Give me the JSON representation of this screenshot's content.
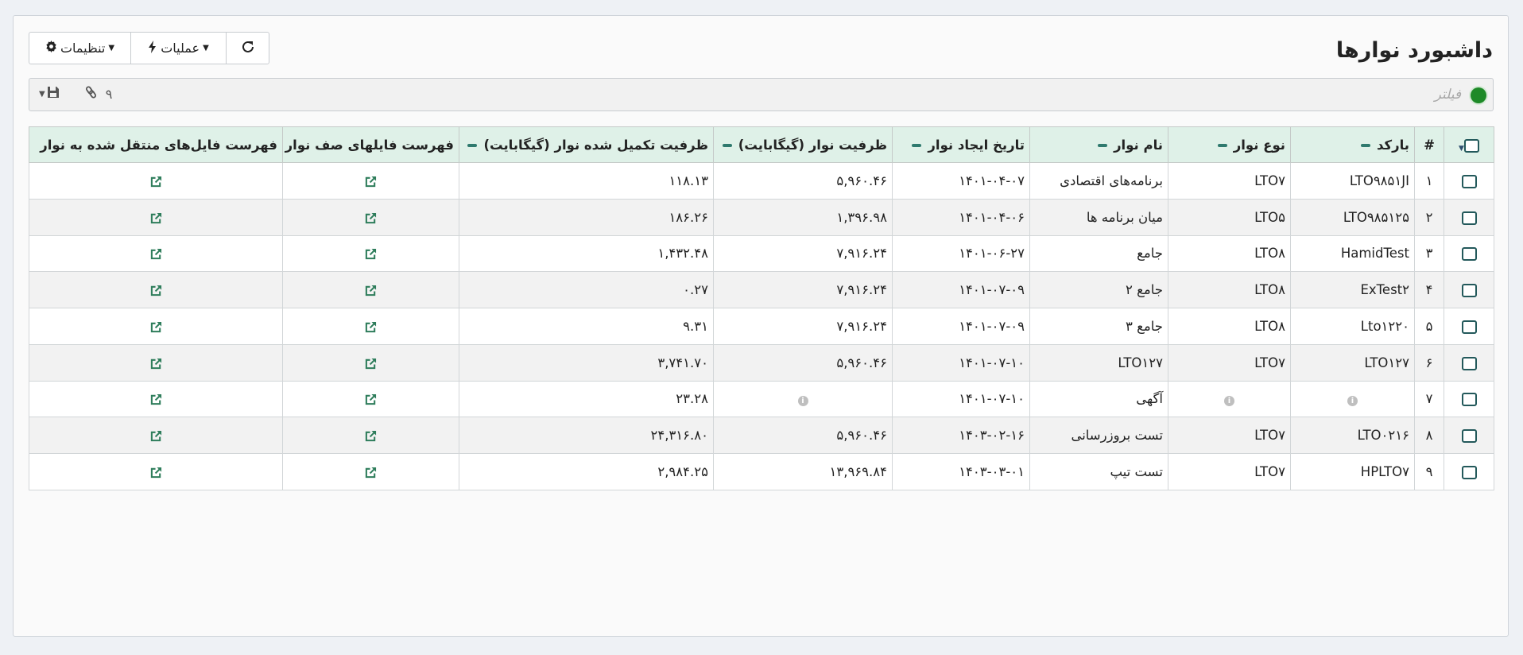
{
  "page": {
    "title": "داشبورد نوارها"
  },
  "toolbar": {
    "settings_label": "تنظیمات",
    "operations_label": "عملیات"
  },
  "filter": {
    "placeholder": "فیلتر",
    "count": "۹",
    "status_color": "#1e8a28"
  },
  "table": {
    "columns": [
      "#",
      "بارکد",
      "نوع نوار",
      "نام نوار",
      "تاریخ ایجاد نوار",
      "ظرفیت نوار (گیگابایت)",
      "ظرفیت تکمیل شده نوار (گیگابایت)",
      "فهرست فایلهای صف نوار",
      "فهرست فایل‌های منتقل شده به نوار"
    ],
    "rows": [
      {
        "num": "۱",
        "barcode": "LTO۹۸۵۱JI",
        "type": "LTO۷",
        "name": "برنامه‌های اقتصادی",
        "date": "۱۴۰۱-۰۴-۰۷",
        "capacity": "۵,۹۶۰.۴۶",
        "used": "۱۱۸.۱۳"
      },
      {
        "num": "۲",
        "barcode": "LTO۹۸۵۱۲۵",
        "type": "LTO۵",
        "name": "میان برنامه ها",
        "date": "۱۴۰۱-۰۴-۰۶",
        "capacity": "۱,۳۹۶.۹۸",
        "used": "۱۸۶.۲۶"
      },
      {
        "num": "۳",
        "barcode": "HamidTest",
        "type": "LTO۸",
        "name": "جامع",
        "date": "۱۴۰۱-۰۶-۲۷",
        "capacity": "۷,۹۱۶.۲۴",
        "used": "۱,۴۳۲.۴۸"
      },
      {
        "num": "۴",
        "barcode": "ExTest۲",
        "type": "LTO۸",
        "name": "جامع ۲",
        "date": "۱۴۰۱-۰۷-۰۹",
        "capacity": "۷,۹۱۶.۲۴",
        "used": "۰.۲۷"
      },
      {
        "num": "۵",
        "barcode": "Lto۱۲۲۰",
        "type": "LTO۸",
        "name": "جامع ۳",
        "date": "۱۴۰۱-۰۷-۰۹",
        "capacity": "۷,۹۱۶.۲۴",
        "used": "۹.۳۱"
      },
      {
        "num": "۶",
        "barcode": "LTO۱۲۷",
        "type": "LTO۷",
        "name": "LTO۱۲۷",
        "date": "۱۴۰۱-۰۷-۱۰",
        "capacity": "۵,۹۶۰.۴۶",
        "used": "۳,۷۴۱.۷۰"
      },
      {
        "num": "۷",
        "barcode": "",
        "type": "",
        "name": "آگهی",
        "date": "۱۴۰۱-۰۷-۱۰",
        "capacity": "",
        "used": "۲۳.۲۸"
      },
      {
        "num": "۸",
        "barcode": "LTO۰۲۱۶",
        "type": "LTO۷",
        "name": "تست بروزرسانی",
        "date": "۱۴۰۳-۰۲-۱۶",
        "capacity": "۵,۹۶۰.۴۶",
        "used": "۲۴,۳۱۶.۸۰"
      },
      {
        "num": "۹",
        "barcode": "HPLTO۷",
        "type": "LTO۷",
        "name": "تست تیپ",
        "date": "۱۴۰۳-۰۳-۰۱",
        "capacity": "۱۳,۹۶۹.۸۴",
        "used": "۲,۹۸۴.۲۵"
      }
    ]
  }
}
